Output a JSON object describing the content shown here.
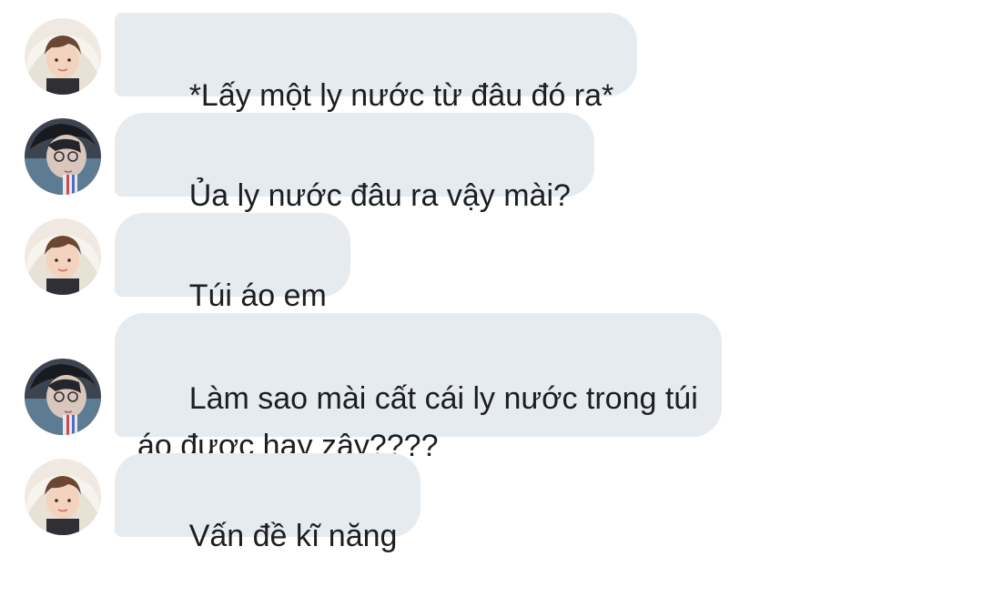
{
  "messages": [
    {
      "sender": "girl",
      "text": "*Lấy một ly nước từ đâu đó ra*"
    },
    {
      "sender": "boy",
      "text": "Ủa ly nước đâu ra vậy mài?"
    },
    {
      "sender": "girl",
      "text": "Túi áo em"
    },
    {
      "sender": "boy",
      "text": "Làm sao mài cất cái ly nước trong túi\náo được hay zậy????"
    },
    {
      "sender": "girl",
      "text": "Vấn đề kĩ năng"
    }
  ],
  "colors": {
    "bubble": "#e6ebf0",
    "text": "#1c1e21",
    "background": "#ffffff"
  },
  "icons": {
    "girl_avatar": "avatar-girl-icon",
    "boy_avatar": "avatar-boy-icon"
  }
}
